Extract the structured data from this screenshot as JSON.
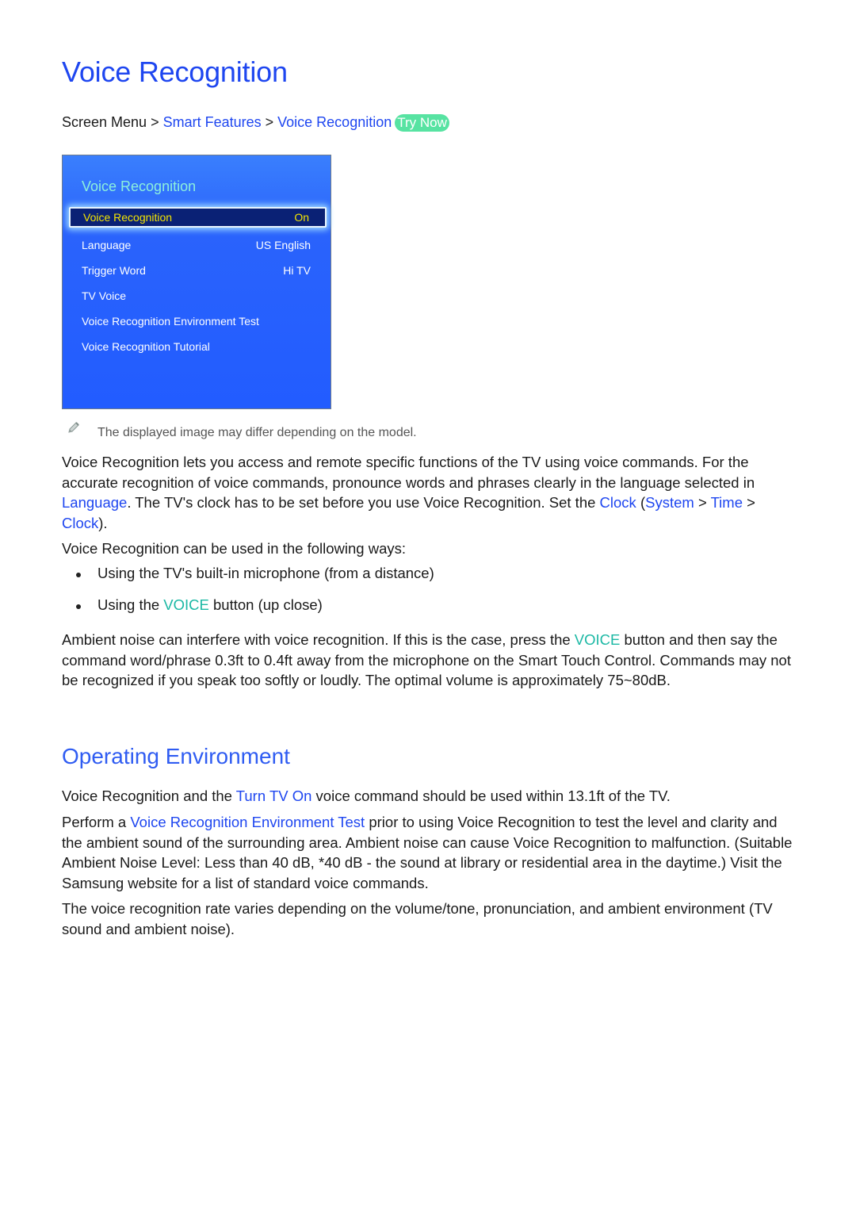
{
  "title": "Voice Recognition",
  "breadcrumb": {
    "root": "Screen Menu",
    "items": [
      "Smart Features",
      "Voice Recognition"
    ],
    "try_now": "Try Now",
    "separator": ">"
  },
  "tv_menu": {
    "title": "Voice Recognition",
    "items": [
      {
        "label": "Voice Recognition",
        "value": "On",
        "selected": true
      },
      {
        "label": "Language",
        "value": "US English"
      },
      {
        "label": "Trigger Word",
        "value": "Hi TV"
      },
      {
        "label": "TV Voice",
        "value": ""
      },
      {
        "label": "Voice Recognition Environment Test",
        "value": ""
      },
      {
        "label": "Voice Recognition Tutorial",
        "value": ""
      }
    ]
  },
  "note": {
    "icon": "pencil-icon",
    "text": "The displayed image may differ depending on the model."
  },
  "intro": {
    "t1": "Voice Recognition lets you access and remote specific functions of the TV using voice commands. For the accurate recognition of voice commands, pronounce words and phrases clearly in the language selected in ",
    "link_language": "Language",
    "t2": ". The TV's clock has to be set before you use Voice Recognition. Set the ",
    "link_clock": "Clock",
    "t3": " (",
    "link_system": "System",
    "sep": " > ",
    "link_time": "Time",
    "link_clock2": "Clock",
    "t4": ")."
  },
  "ways": {
    "lead": "Voice Recognition can be used in the following ways:",
    "b1": "Using the TV's built-in microphone (from a distance)",
    "b2_pre": "Using the ",
    "b2_key": "VOICE",
    "b2_post": " button (up close)"
  },
  "ambient": {
    "t1": "Ambient noise can interfere with voice recognition. If this is the case, press the ",
    "key": "VOICE",
    "t2": " button and then say the command word/phrase 0.3ft to 0.4ft away from the microphone on the Smart Touch Control. Commands may not be recognized if you speak too softly or loudly. The optimal volume is approximately 75~80dB."
  },
  "operating": {
    "heading": "Operating Environment",
    "p1_pre": "Voice Recognition and the ",
    "p1_link": "Turn TV On",
    "p1_post": " voice command should be used within 13.1ft of the TV.",
    "p2_pre": "Perform a ",
    "p2_link": "Voice Recognition Environment Test",
    "p2_post": " prior to using Voice Recognition to test the level and clarity and the ambient sound of the surrounding area. Ambient noise can cause Voice Recognition to malfunction. (Suitable Ambient Noise Level: Less than 40 dB, *40 dB - the sound at library or residential area in the daytime.) Visit the Samsung website for a list of standard voice commands.",
    "p3": "The voice recognition rate varies depending on the volume/tone, pronunciation, and ambient environment (TV sound and ambient noise)."
  },
  "colors": {
    "link": "#1e46f0",
    "key": "#1bb8a4",
    "try_now_bg": "#57e3a2",
    "tv_bg": "#225cff",
    "tv_selected_bg": "#0a2175",
    "tv_selected_text": "#f4e500",
    "tv_title": "#8cf0dc"
  }
}
